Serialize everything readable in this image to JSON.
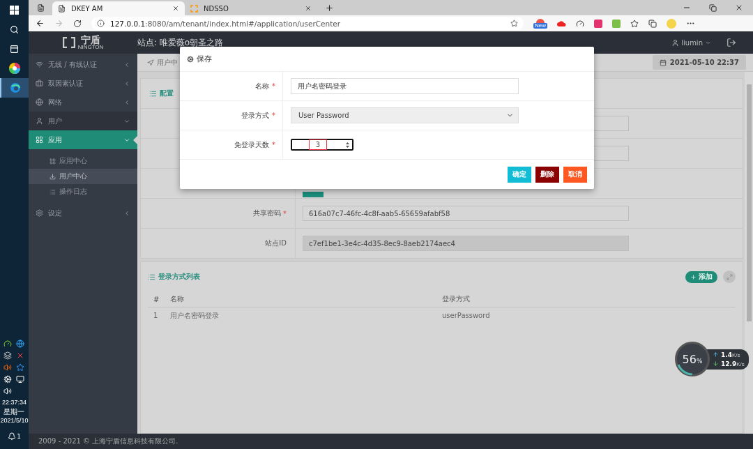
{
  "taskbar": {
    "clock": "22:37:34",
    "weekday": "星期一",
    "date": "2021/5/10",
    "notification_count": "1"
  },
  "browser": {
    "tabs": [
      {
        "title": "DKEY AM",
        "selected": true
      },
      {
        "title": "NDSSO",
        "selected": false
      }
    ],
    "url_host": "127.0.0.1",
    "url_path": ":8080/am/tenant/index.html#/application/userCenter",
    "extension_badge": "New"
  },
  "header": {
    "logo": "宁盾",
    "logo_sub": "NINGTON",
    "site": "站点: 唯爱薇o朝圣之路",
    "user": "liumin"
  },
  "sidebar": {
    "items": [
      {
        "label": "无线 / 有线认证",
        "selected": false,
        "expanded": false
      },
      {
        "label": "双因素认证",
        "selected": false,
        "expanded": false
      },
      {
        "label": "网络",
        "selected": false,
        "expanded": false
      },
      {
        "label": "用户",
        "selected": false,
        "expanded": true
      },
      {
        "label": "应用",
        "selected": true,
        "expanded": true,
        "children": [
          {
            "label": "应用中心",
            "selected": false
          },
          {
            "label": "用户中心",
            "selected": true
          },
          {
            "label": "操作日志",
            "selected": false
          }
        ]
      },
      {
        "label": "设定",
        "selected": false,
        "expanded": false
      }
    ]
  },
  "breadcrumb": "用户中",
  "datetime": "2021-05-10 22:37",
  "config": {
    "title": "配置",
    "fields": [
      {
        "kind": "input"
      },
      {
        "kind": "input"
      },
      {
        "kind": "button"
      },
      {
        "kind": "input",
        "label": "共享密码",
        "required_mark": "*",
        "readonly": false,
        "value": "616a07c7-46fc-4c8f-aab5-65659afabf58"
      },
      {
        "kind": "input",
        "label": "站点ID",
        "readonly": true,
        "value": "c7ef1be1-3e4c-4d35-8ec9-8aeb2174aec4"
      }
    ]
  },
  "login_list": {
    "title": "登录方式列表",
    "add_button": "添加",
    "columns": [
      "#",
      "名称",
      "登录方式"
    ],
    "rows": [
      [
        "1",
        "用户名密码登录",
        "userPassword"
      ]
    ]
  },
  "footer": "2009 - 2021 © 上海宁盾信息科技有限公司.",
  "modal": {
    "title": "保存",
    "fields": [
      {
        "kind": "text",
        "label": "名称",
        "required_mark": "*",
        "value": "用户名密码登录"
      },
      {
        "kind": "select",
        "label": "登录方式",
        "required_mark": "*",
        "value": "User Password"
      },
      {
        "kind": "number",
        "label": "免登录天数",
        "required_mark": "*",
        "value": "3"
      }
    ],
    "buttons": [
      {
        "kind": "confirm",
        "label": "确定"
      },
      {
        "kind": "danger",
        "label": "删除"
      },
      {
        "kind": "cancel",
        "label": "取消"
      }
    ]
  },
  "net_monitor": {
    "usage": "56",
    "usage_unit": "%",
    "up": "1.4",
    "up_unit": "K/s",
    "down": "12.9",
    "down_unit": "K/s"
  }
}
